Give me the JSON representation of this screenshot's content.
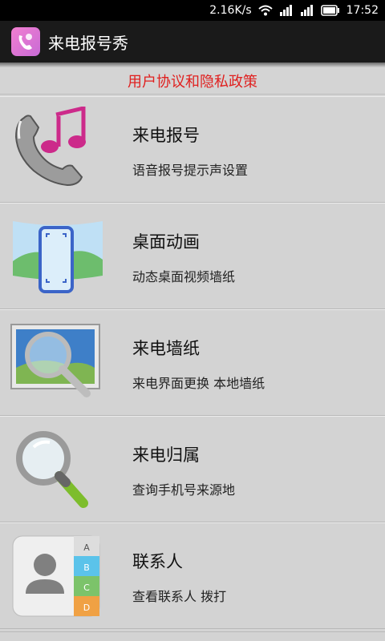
{
  "status_bar": {
    "speed": "2.16K/s",
    "time": "17:52"
  },
  "app": {
    "title": "来电报号秀"
  },
  "policy": {
    "label": "用户协议和隐私政策"
  },
  "items": [
    {
      "title": "来电报号",
      "subtitle": "语音报号提示声设置",
      "icon": "phone-music-icon"
    },
    {
      "title": "桌面动画",
      "subtitle": "动态桌面视频墙纸",
      "icon": "phone-wallpaper-icon"
    },
    {
      "title": "来电墙纸",
      "subtitle": "来电界面更换 本地墙纸",
      "icon": "picture-magnifier-icon"
    },
    {
      "title": "来电归属",
      "subtitle": "查询手机号来源地",
      "icon": "magnifier-icon"
    },
    {
      "title": "联系人",
      "subtitle": "查看联系人 拨打",
      "icon": "contacts-icon"
    }
  ],
  "contacts_tabs": [
    "A",
    "B",
    "C",
    "D"
  ],
  "colors": {
    "policy_text": "#e0201f",
    "title_bar": "#1a1a1a",
    "status_bar": "#000000",
    "list_bg": "#d3d3d3"
  }
}
